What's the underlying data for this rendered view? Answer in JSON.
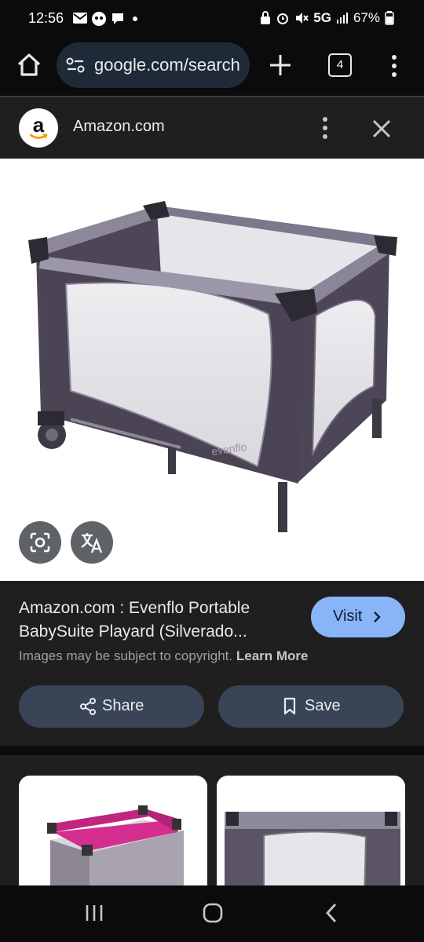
{
  "status_bar": {
    "time": "12:56",
    "network": "5G",
    "battery": "67%",
    "left_icons": [
      "mail-icon",
      "wrestling-app-icon",
      "chat-icon",
      "dot-icon"
    ],
    "right_icons": [
      "lock-icon",
      "alarm-icon",
      "mute-icon",
      "signal-icon",
      "battery-icon"
    ]
  },
  "browser": {
    "url": "google.com/search",
    "tab_count": "4"
  },
  "result_sheet": {
    "site_name": "Amazon.com",
    "logo_letter": "a",
    "product_title": "Amazon.com : Evenflo Portable BabySuite Playard (Silverado...",
    "visit_label": "Visit",
    "copyright_text": "Images may be subject to copyright.",
    "learn_more": "Learn More",
    "share_label": "Share",
    "save_label": "Save",
    "product_brand_mark": "evenflo"
  },
  "colors": {
    "accent": "#8ab4f8",
    "pill_bg": "#394457",
    "sheet_bg": "#1f1f1f"
  }
}
